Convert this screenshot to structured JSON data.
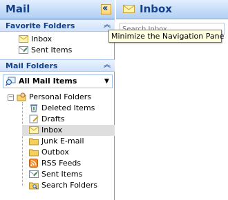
{
  "nav": {
    "title": "Mail",
    "collapse_button_icon": "double-chevron-left-icon"
  },
  "favorites": {
    "title": "Favorite Folders",
    "items": [
      {
        "label": "Inbox",
        "icon": "inbox-icon"
      },
      {
        "label": "Sent Items",
        "icon": "sent-items-icon"
      }
    ]
  },
  "mail_folders": {
    "title": "Mail Folders",
    "view_selector": "All Mail Items",
    "root": "Personal Folders",
    "items": [
      {
        "label": "Deleted Items",
        "icon": "deleted-items-icon"
      },
      {
        "label": "Drafts",
        "icon": "drafts-icon"
      },
      {
        "label": "Inbox",
        "icon": "inbox-icon",
        "selected": true
      },
      {
        "label": "Junk E-mail",
        "icon": "junk-email-icon"
      },
      {
        "label": "Outbox",
        "icon": "outbox-icon"
      },
      {
        "label": "RSS Feeds",
        "icon": "rss-feeds-icon"
      },
      {
        "label": "Sent Items",
        "icon": "sent-items-icon"
      },
      {
        "label": "Search Folders",
        "icon": "search-folders-icon"
      }
    ]
  },
  "content": {
    "title": "Inbox",
    "search_placeholder": "Search Inbox"
  },
  "tooltip": "Minimize the Navigation Pane",
  "colors": {
    "header_text": "#15428b",
    "selected_row": "#dedede",
    "tooltip_bg": "#ffffe1",
    "accent_button": "#ffd36b"
  }
}
